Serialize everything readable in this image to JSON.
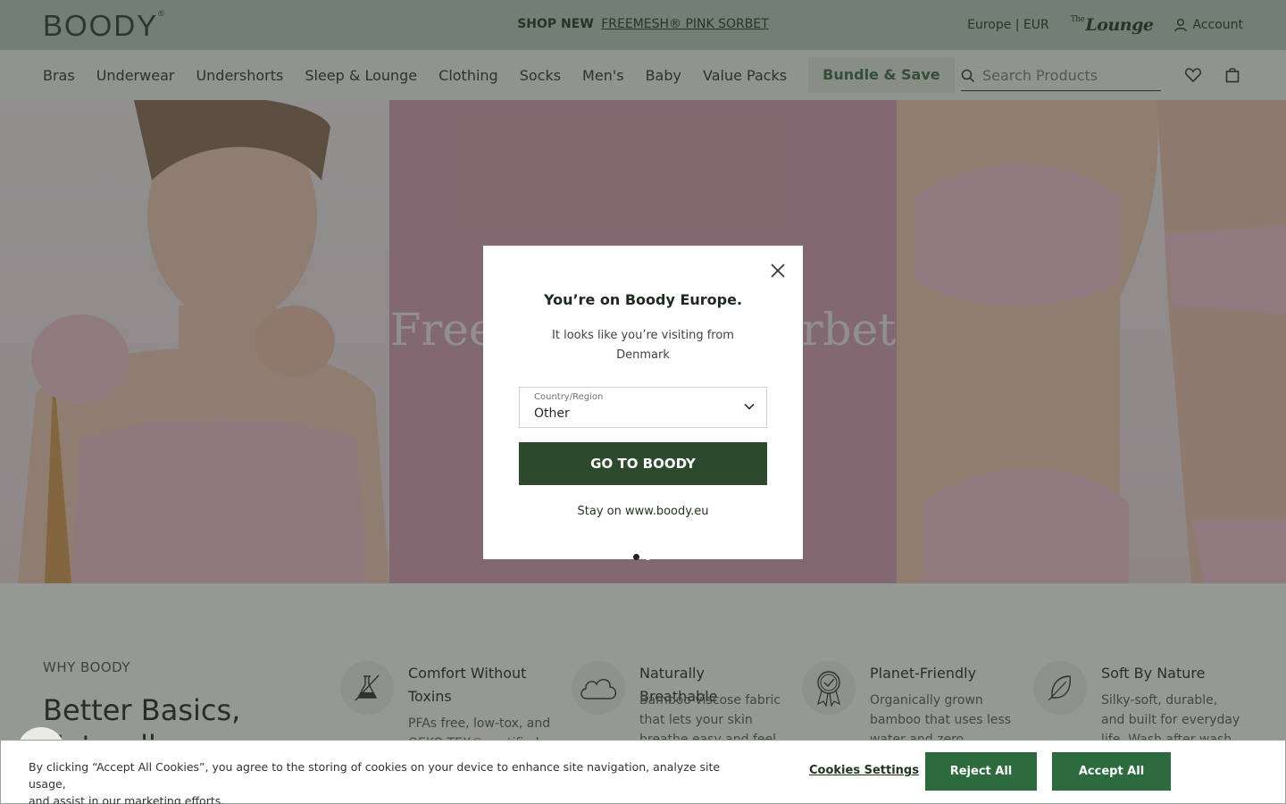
{
  "brand": {
    "logo": "BOODY",
    "logo_mark": "®"
  },
  "topbar": {
    "promo_bold": "SHOP NEW",
    "promo_link": "FREEMESH® PINK SORBET",
    "region": "Europe | EUR",
    "lounge_prefix": "The",
    "lounge": "Lounge",
    "account": "Account"
  },
  "nav": {
    "items": [
      "Bras",
      "Underwear",
      "Undershorts",
      "Sleep & Lounge",
      "Clothing",
      "Socks",
      "Men's",
      "Baby",
      "Value Packs"
    ],
    "bundle": "Bundle & Save",
    "search_placeholder": "Search Products"
  },
  "hero": {
    "title": "Freemesh Pink Sorbet",
    "slides": 2,
    "active_slide": 1
  },
  "why": {
    "label": "WHY BOODY",
    "title_line1": "Better Basics,",
    "title_line2": "Naturally.",
    "features": [
      {
        "icon": "flask-icon",
        "title": "Comfort Without Toxins",
        "text": "PFAs free, low-tox, and OEKO-TEX® certified."
      },
      {
        "icon": "cloud-icon",
        "title": "Naturally Breathable",
        "text": "Bamboo viscose fabric that lets your skin breathe easy and feel fresh."
      },
      {
        "icon": "award-icon",
        "title": "Planet-Friendly",
        "text": "Organically grown bamboo that uses less water and zero pesticides."
      },
      {
        "icon": "feather-icon",
        "title": "Soft By Nature",
        "text": "Silky-soft, durable, and built for everyday life. Wash after wash, wear after wear."
      }
    ]
  },
  "modal": {
    "title": "You’re on Boody Europe.",
    "text_line1": "It looks like you’re visiting from",
    "text_line2": "Denmark",
    "select_label": "Country/Region",
    "select_value": "Other",
    "go_button": "GO TO BOODY",
    "stay_link": "Stay on www.boody.eu"
  },
  "cookie": {
    "text_line1": "By clicking “Accept All Cookies”, you agree to the storing of cookies on your device to enhance site navigation, analyze site usage,",
    "text_line2": "and assist in our marketing efforts.",
    "settings": "Cookies Settings",
    "reject": "Reject All",
    "accept": "Accept All Cookies"
  },
  "colors": {
    "topbar": "#b7ccbb",
    "hero_mid": "#d7a1b4",
    "primary_button": "#2d4a2e",
    "cookie_button": "#2d6a3e",
    "bundle_text": "#3a6a45"
  }
}
